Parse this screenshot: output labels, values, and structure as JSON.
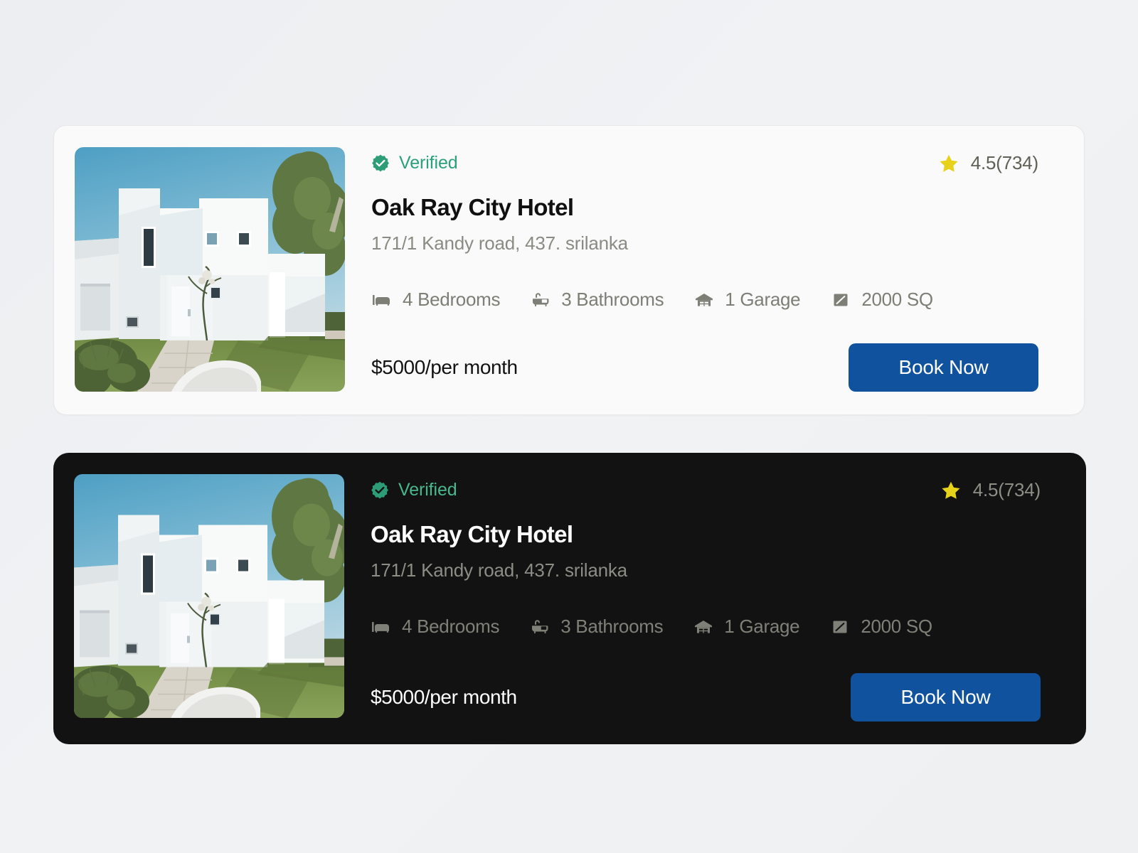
{
  "cards": [
    {
      "theme": "light",
      "verified": {
        "label": "Verified",
        "icon": "verified-badge-icon",
        "color": "#2aa179"
      },
      "rating": {
        "icon": "star-icon",
        "icon_color": "#e8d11a",
        "value": "4.5(734)",
        "score": 4.5,
        "count": 734
      },
      "title": "Oak Ray City Hotel",
      "address": "171/1 Kandy road, 437. srilanka",
      "amenities": [
        {
          "icon": "bed-icon",
          "label": "4 Bedrooms"
        },
        {
          "icon": "bathtub-icon",
          "label": "3 Bathrooms"
        },
        {
          "icon": "garage-icon",
          "label": "1 Garage"
        },
        {
          "icon": "area-icon",
          "label": "2000 SQ"
        }
      ],
      "price": "$5000/per month",
      "cta_label": "Book Now",
      "cta_color": "#10529e",
      "photo_alt": "modern white minimalist house with blue sky, pine tree and green lawn"
    },
    {
      "theme": "dark",
      "verified": {
        "label": "Verified",
        "icon": "verified-badge-icon",
        "color": "#49b78e"
      },
      "rating": {
        "icon": "star-icon",
        "icon_color": "#e8d11a",
        "value": "4.5(734)",
        "score": 4.5,
        "count": 734
      },
      "title": "Oak Ray City Hotel",
      "address": "171/1 Kandy road, 437. srilanka",
      "amenities": [
        {
          "icon": "bed-icon",
          "label": "4 Bedrooms"
        },
        {
          "icon": "bathtub-icon",
          "label": "3 Bathrooms"
        },
        {
          "icon": "garage-icon",
          "label": "1 Garage"
        },
        {
          "icon": "area-icon",
          "label": "2000 SQ"
        }
      ],
      "price": "$5000/per month",
      "cta_label": "Book Now",
      "cta_color": "#10529e",
      "photo_alt": "modern white minimalist house with blue sky, pine tree and green lawn"
    }
  ],
  "theme_colors": {
    "page_background": "#eef0f2",
    "light_card_background": "#fafafa",
    "light_card_border": "#e8e8ea",
    "dark_card_background": "#121212",
    "accent_blue": "#10529e",
    "verified_green_light": "#2aa179",
    "verified_green_dark": "#49b78e",
    "star_yellow": "#e8d11a",
    "muted_text": "#7d7e75"
  }
}
